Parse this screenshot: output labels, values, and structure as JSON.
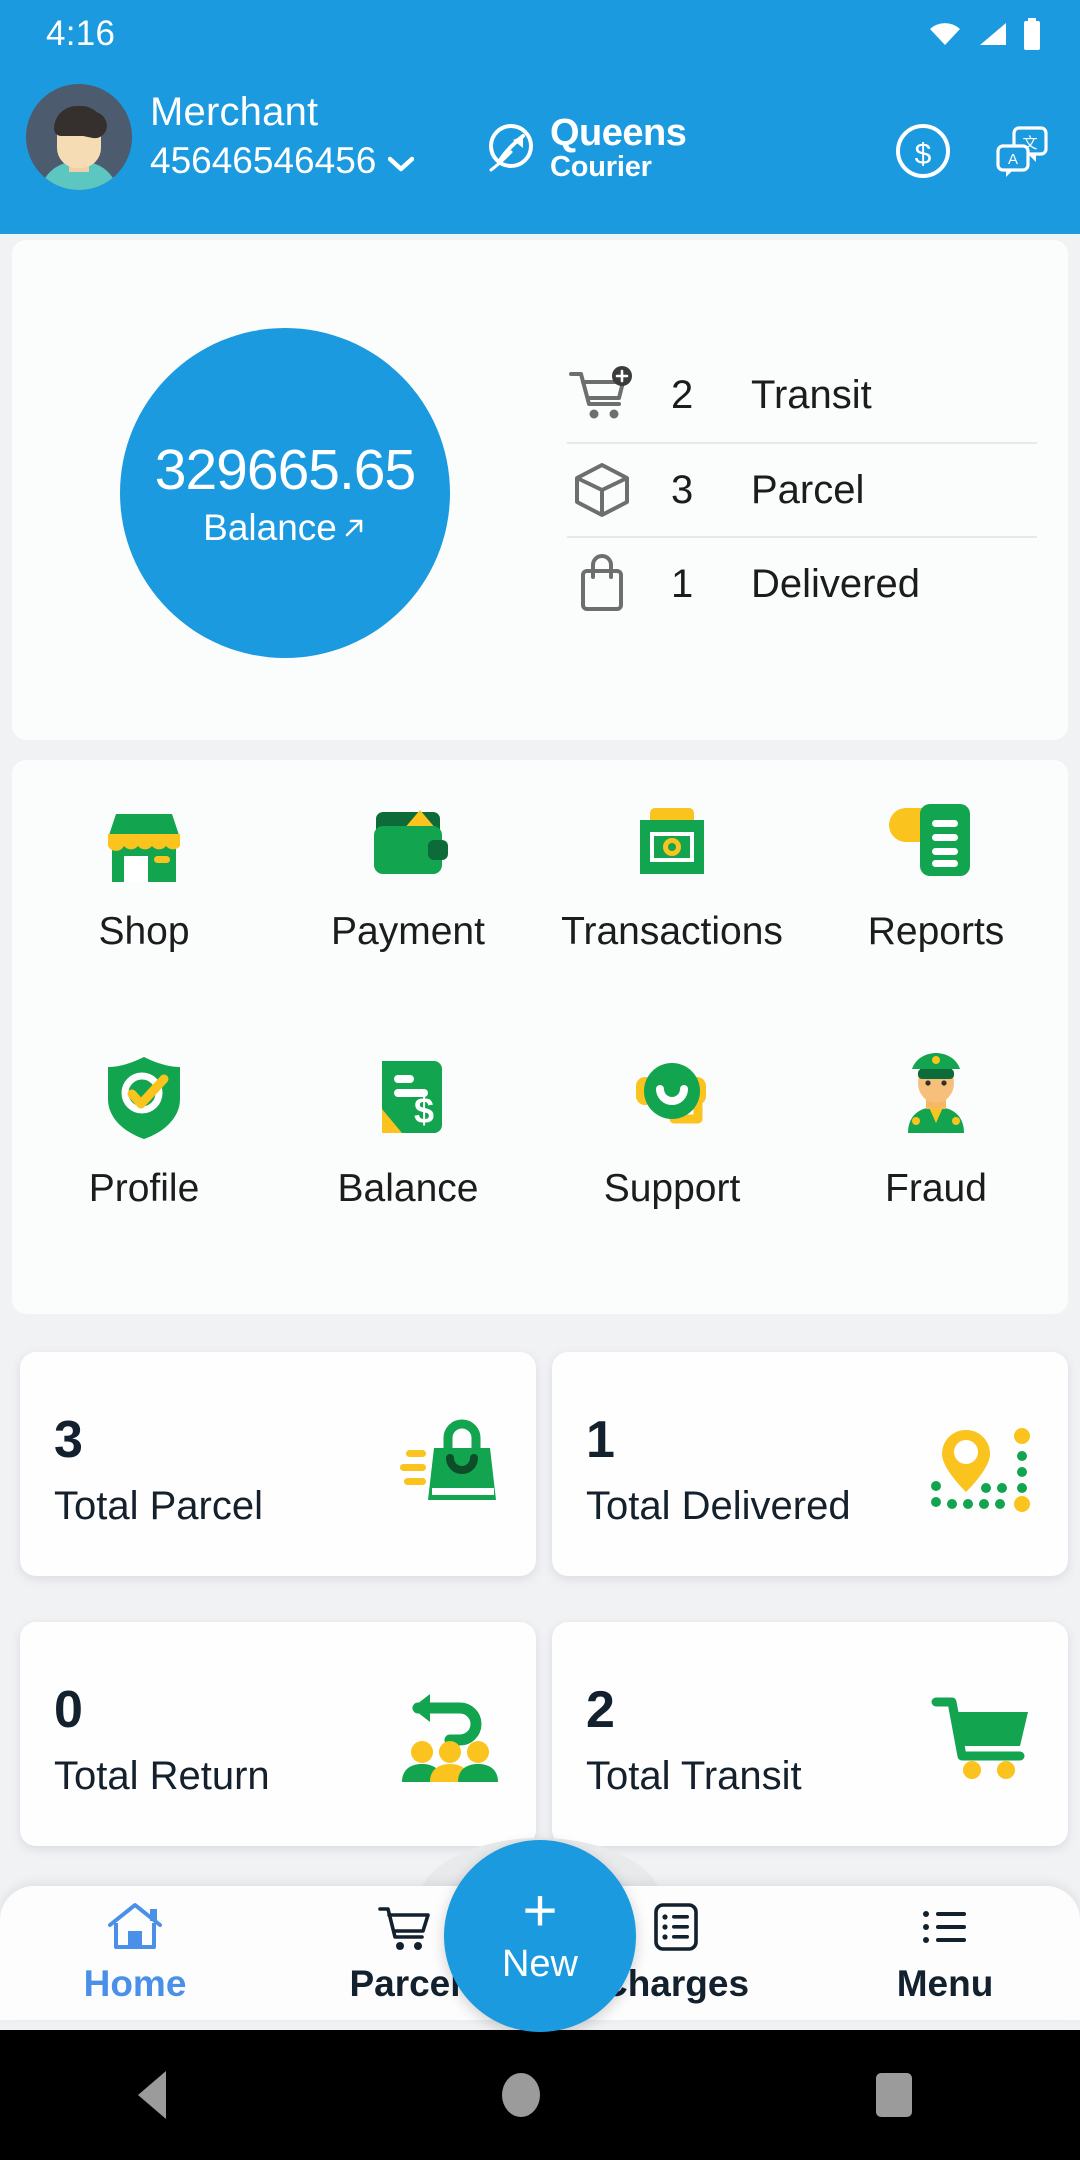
{
  "status_bar": {
    "time": "4:16",
    "icons": [
      "wifi-icon",
      "signal-icon",
      "battery-icon"
    ]
  },
  "header": {
    "account_name": "Merchant",
    "account_id": "45646546456",
    "dropdown_icon": "chevron-down-icon",
    "avatar_icon": "avatar",
    "brand_line1": "Queens",
    "brand_line2": "Courier",
    "brand_logo_icon": "queens-courier-logo-icon",
    "actions": [
      {
        "name": "currency-icon",
        "label": "$"
      },
      {
        "name": "translate-icon",
        "label": "文A"
      }
    ],
    "background_color": "#1b9ae0"
  },
  "balance": {
    "amount": "329665.65",
    "label": "Balance",
    "trend_icon": "arrow-up-right-icon",
    "circle_color": "#1b9ae0",
    "stats": [
      {
        "icon": "cart-plus-icon",
        "count": "2",
        "label": "Transit"
      },
      {
        "icon": "box-icon",
        "count": "3",
        "label": "Parcel"
      },
      {
        "icon": "shopping-bag-icon",
        "count": "1",
        "label": "Delivered"
      }
    ]
  },
  "menu_grid": [
    {
      "icon": "shop-icon",
      "label": "Shop"
    },
    {
      "icon": "wallet-icon",
      "label": "Payment"
    },
    {
      "icon": "banknote-icon",
      "label": "Transactions"
    },
    {
      "icon": "document-icon",
      "label": "Reports"
    },
    {
      "icon": "shield-check-icon",
      "label": "Profile"
    },
    {
      "icon": "invoice-dollar-icon",
      "label": "Balance"
    },
    {
      "icon": "headset-icon",
      "label": "Support"
    },
    {
      "icon": "police-officer-icon",
      "label": "Fraud"
    }
  ],
  "stat_cards": [
    {
      "value": "3",
      "label": "Total Parcel",
      "icon": "delivery-bag-icon"
    },
    {
      "value": "1",
      "label": "Total Delivered",
      "icon": "map-route-icon"
    },
    {
      "value": "0",
      "label": "Total Return",
      "icon": "return-people-icon"
    },
    {
      "value": "2",
      "label": "Total Transit",
      "icon": "shopping-cart-icon"
    }
  ],
  "fab": {
    "plus": "+",
    "label": "New",
    "color": "#1b9ae0"
  },
  "bottom_nav": {
    "active_index": 0,
    "items": [
      {
        "icon": "home-icon",
        "label": "Home"
      },
      {
        "icon": "cart-icon",
        "label": "Parcel"
      },
      {
        "icon": "list-box-icon",
        "label": "Charges"
      },
      {
        "icon": "list-icon",
        "label": "Menu"
      }
    ],
    "active_color": "#4a90e8"
  },
  "system_nav": {
    "back_icon": "android-back-icon",
    "home_icon": "android-home-icon",
    "recents_icon": "android-recents-icon"
  },
  "theme": {
    "primary": "#1b9ae0",
    "green": "#12a44f",
    "yellow": "#fac31e",
    "dark_green": "#0d6b39",
    "text": "#13202e"
  }
}
